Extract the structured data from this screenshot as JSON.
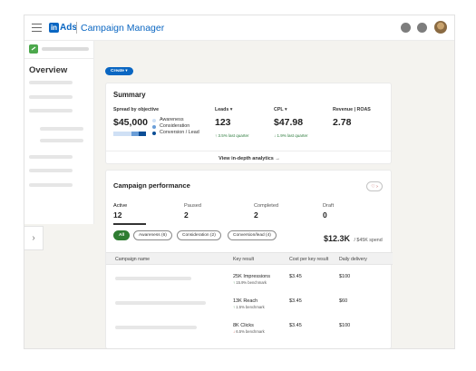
{
  "topbar": {
    "logo_box": "in",
    "logo_text": "Ads",
    "app_title": "Campaign Manager"
  },
  "sidebar": {
    "overview_label": "Overview",
    "collapse_icon": "›"
  },
  "create_button": "Create",
  "create_caret": "▾",
  "summary": {
    "title": "Summary",
    "spread": {
      "label": "Spread by objective",
      "value": "$45,000",
      "legend": [
        {
          "label": "Awareness",
          "color": "#cfe0f5"
        },
        {
          "label": "Consideration",
          "color": "#6a9ed8"
        },
        {
          "label": "Conversion / Lead",
          "color": "#0a4d95"
        }
      ]
    },
    "leads": {
      "label": "Leads ▾",
      "value": "123",
      "trend_arrow": "↑",
      "trend": "3.5%  last quarter"
    },
    "cpl": {
      "label": "CPL ▾",
      "value": "$47.98",
      "trend_arrow": "↓",
      "trend": "1.9%  last quarter"
    },
    "revenue": {
      "label": "Revenue | ROAS",
      "value": "2.78"
    },
    "footer_link": "View in-depth analytics  →"
  },
  "performance": {
    "title": "Campaign performance",
    "icon_button": "♡ ›",
    "tabs": [
      {
        "label": "Active",
        "value": "12"
      },
      {
        "label": "Paused",
        "value": "2"
      },
      {
        "label": "Completed",
        "value": "2"
      },
      {
        "label": "Draft",
        "value": "0"
      }
    ],
    "filters": [
      "All",
      "Awareness (6)",
      "Consideration (2)",
      "Conversion/lead (4)"
    ],
    "spend_value": "$12.3K",
    "spend_budget": "/ $45K spend",
    "columns": [
      "Campaign name",
      "Key result",
      "Cost per key result",
      "Daily delivery"
    ],
    "rows": [
      {
        "key_result": "25K Impressions",
        "trend_arrow": "↑",
        "trend": "15.9% benchmark",
        "trend_dir": "up",
        "cost": "$3.45",
        "daily": "$100"
      },
      {
        "key_result": "13K Reach",
        "trend_arrow": "↑",
        "trend": "1.5% benchmark",
        "trend_dir": "up",
        "cost": "$3.45",
        "daily": "$60"
      },
      {
        "key_result": "8K Clicks",
        "trend_arrow": "↓",
        "trend": "6.5% benchmark",
        "trend_dir": "down",
        "cost": "$3.45",
        "daily": "$100"
      }
    ]
  }
}
